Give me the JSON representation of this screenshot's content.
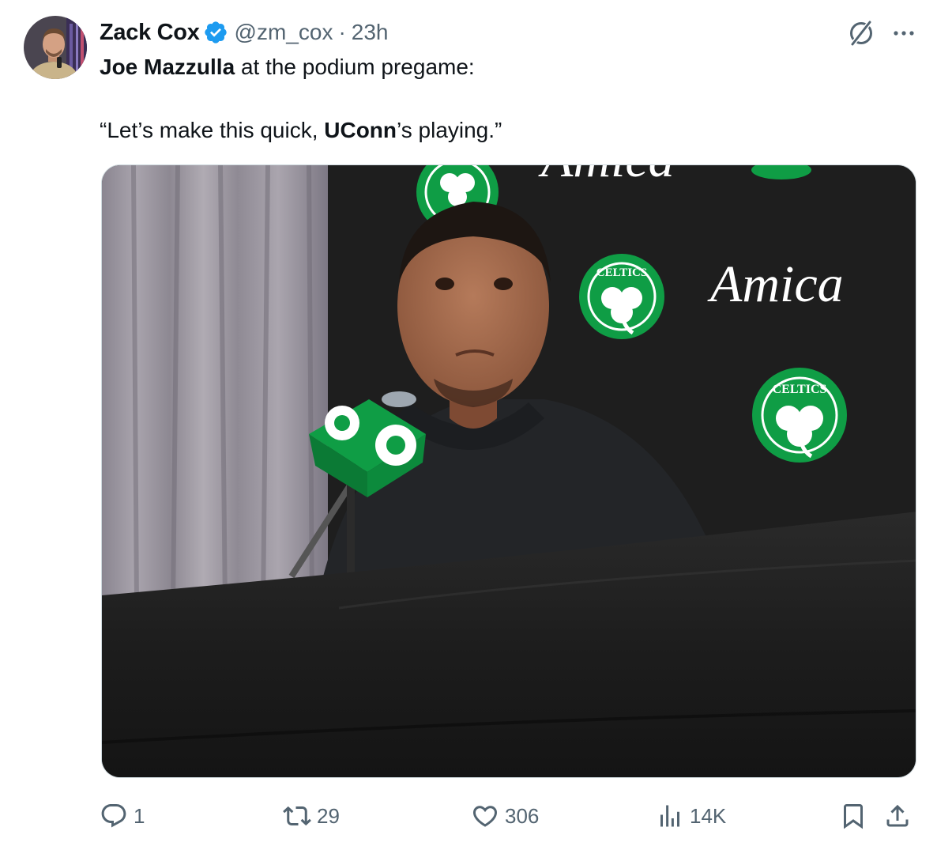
{
  "tweet": {
    "author_name": "Zack Cox",
    "handle": "@zm_cox",
    "separator": "·",
    "time": "23h",
    "text_line1_bold": "Joe Mazzulla",
    "text_line1_rest": " at the podium pregame:",
    "quote_open": "“Let’s make this quick, ",
    "quote_bold": "UConn",
    "quote_close": "’s playing.”"
  },
  "media": {
    "backdrop_brand": "Amica",
    "logo_text": "CELTICS"
  },
  "actions": {
    "replies": "1",
    "reposts": "29",
    "likes": "306",
    "views": "14K"
  },
  "colors": {
    "verified_blue": "#1d9bf0",
    "muted_text": "#536471",
    "celtics_green": "#0f9d45"
  },
  "icons": [
    "verified-badge-icon",
    "grok-icon",
    "more-icon",
    "reply-icon",
    "repost-icon",
    "like-icon",
    "views-icon",
    "bookmark-icon",
    "share-icon"
  ]
}
